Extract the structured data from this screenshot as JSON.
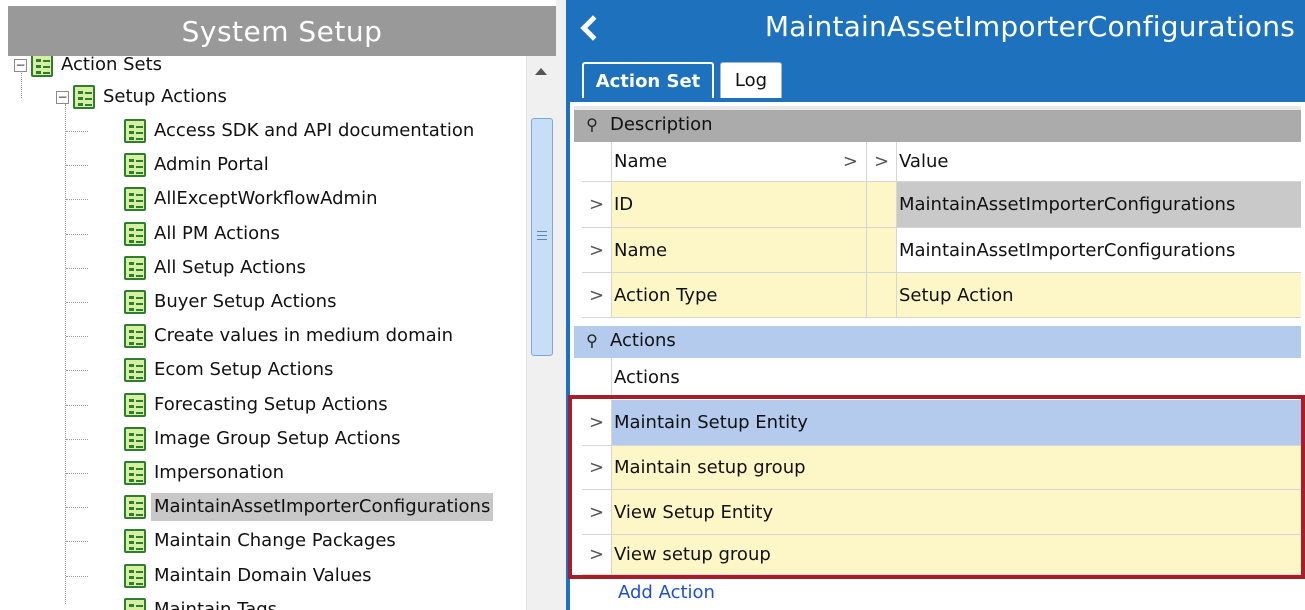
{
  "left_pane": {
    "title": "System Setup",
    "tree": {
      "root": {
        "label": "Action Sets",
        "expander": "−"
      },
      "setup": {
        "label": "Setup Actions",
        "expander": "−"
      },
      "items": [
        {
          "label": "Access SDK and API documentation"
        },
        {
          "label": "Admin Portal"
        },
        {
          "label": "AllExceptWorkflowAdmin"
        },
        {
          "label": "All PM Actions"
        },
        {
          "label": "All Setup Actions"
        },
        {
          "label": "Buyer Setup Actions"
        },
        {
          "label": "Create values in medium domain"
        },
        {
          "label": "Ecom Setup Actions"
        },
        {
          "label": "Forecasting Setup Actions"
        },
        {
          "label": "Image Group Setup Actions"
        },
        {
          "label": "Impersonation"
        },
        {
          "label": "MaintainAssetImporterConfigurations",
          "selected": true
        },
        {
          "label": "Maintain Change Packages"
        },
        {
          "label": "Maintain Domain Values"
        },
        {
          "label": "Maintain Tags"
        }
      ]
    }
  },
  "right_pane": {
    "title": "MaintainAssetImporterConfigurations",
    "tabs": [
      {
        "label": "Action Set",
        "active": true
      },
      {
        "label": "Log",
        "active": false
      }
    ],
    "description": {
      "header": "Description",
      "pin_icon": "⚲",
      "col_name": "Name",
      "col_value": "Value",
      "chevron": ">",
      "rows": [
        {
          "name": "ID",
          "value": "MaintainAssetImporterConfigurations"
        },
        {
          "name": "Name",
          "value": "MaintainAssetImporterConfigurations"
        },
        {
          "name": "Action Type",
          "value": "Setup Action"
        }
      ]
    },
    "actions": {
      "header": "Actions",
      "col": "Actions",
      "rows": [
        {
          "label": "Maintain Setup Entity",
          "selected": true
        },
        {
          "label": "Maintain setup group"
        },
        {
          "label": "View Setup Entity"
        },
        {
          "label": "View setup group"
        }
      ],
      "add_label": "Add Action"
    }
  },
  "colors": {
    "accent_blue": "#1e72bd",
    "highlight_red": "#a61d2b",
    "row_yellow": "#fdf7c8",
    "selected_blue": "#b4cbed"
  }
}
